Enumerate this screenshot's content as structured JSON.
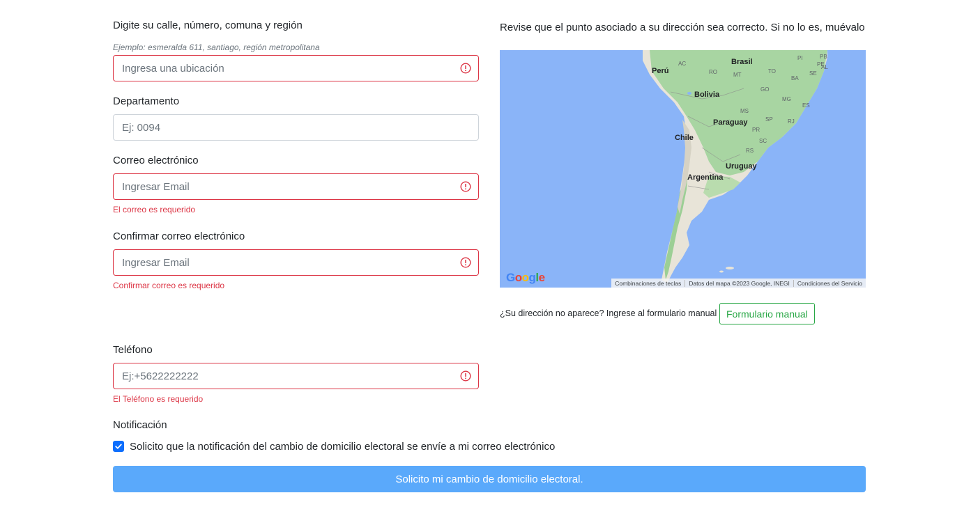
{
  "address": {
    "label": "Digite su calle, número, comuna y región",
    "hint": "Ejemplo: esmeralda 611, santiago, región metropolitana",
    "placeholder": "Ingresa una ubicación"
  },
  "apartment": {
    "label": "Departamento",
    "placeholder": "Ej: 0094"
  },
  "email": {
    "label": "Correo electrónico",
    "placeholder": "Ingresar Email",
    "error": "El correo es requerido"
  },
  "confirm_email": {
    "label": "Confirmar correo electrónico",
    "placeholder": "Ingresar Email",
    "error": "Confirmar correo es requerido"
  },
  "phone": {
    "label": "Teléfono",
    "placeholder": "Ej:+5622222222",
    "error": "El Teléfono es requerido"
  },
  "map": {
    "instruction": "Revise que el punto asociado a su dirección sea correcto. Si no lo es, muévalo",
    "countries": {
      "peru": "Perú",
      "brasil": "Brasil",
      "bolivia": "Bolivia",
      "paraguay": "Paraguay",
      "chile": "Chile",
      "uruguay": "Uruguay",
      "argentina": "Argentina"
    },
    "regions": [
      "AC",
      "RO",
      "MT",
      "TO",
      "GO",
      "MG",
      "MS",
      "SP",
      "RJ",
      "PR",
      "SC",
      "RS",
      "PI",
      "PE",
      "BA",
      "ES",
      "AL",
      "PB",
      "SE"
    ],
    "logo": "Google",
    "attribution": {
      "shortcuts": "Combinaciones de teclas",
      "data": "Datos del mapa ©2023 Google, INEGI",
      "terms": "Condiciones del Servicio"
    }
  },
  "manual": {
    "question": "¿Su dirección no aparece? Ingrese al formulario manual",
    "button": "Formulario manual"
  },
  "notification": {
    "label": "Notificación",
    "checkbox_label": "Solicito que la notificación del cambio de domicilio electoral se envíe a mi correo electrónico",
    "checked": true
  },
  "submit": {
    "label": "Solicito mi cambio de domicilio electoral."
  },
  "colors": {
    "error": "#dc3545",
    "success": "#28a745",
    "primary_disabled": "#5aa9fb",
    "checkbox": "#0d6efd",
    "ocean": "#8ab4f8"
  }
}
